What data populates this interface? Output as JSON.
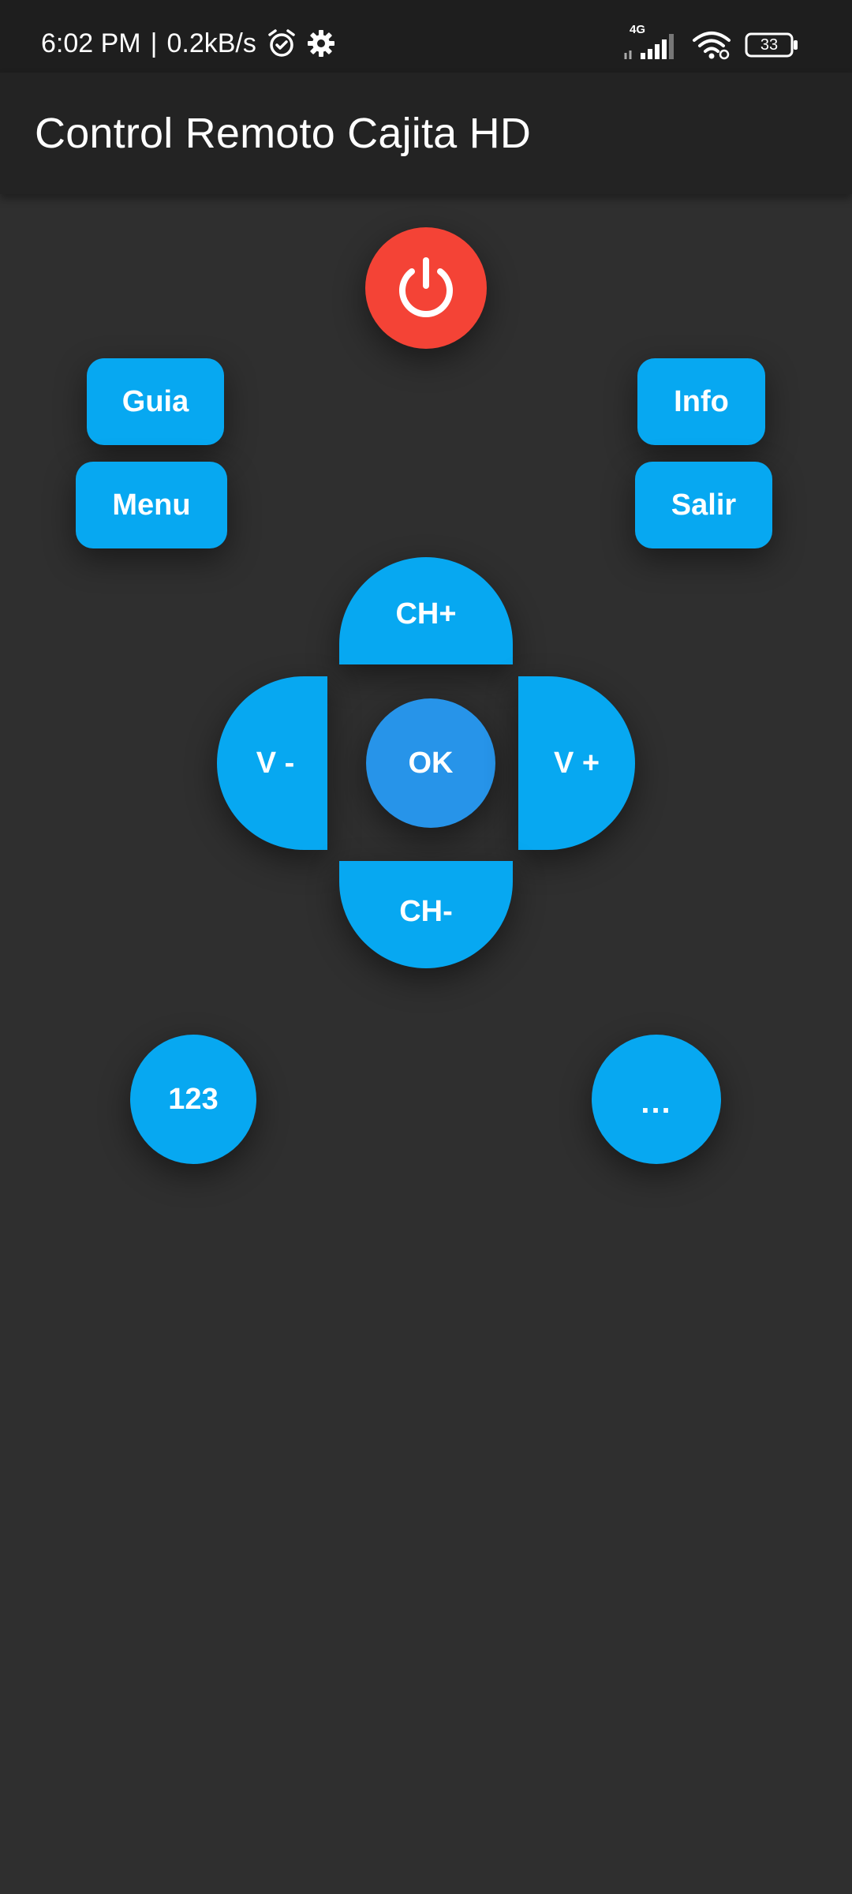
{
  "status_bar": {
    "time": "6:02 PM",
    "separator": "|",
    "speed": "0.2kB/s",
    "network": "4G",
    "battery": "33",
    "icons": [
      "alarm-icon",
      "gear-icon",
      "signal-icon",
      "wifi-icon",
      "battery-icon"
    ]
  },
  "app_bar": {
    "title": "Control Remoto Cajita HD"
  },
  "remote": {
    "power_icon": "power-icon",
    "guia": "Guia",
    "info": "Info",
    "menu": "Menu",
    "salir": "Salir",
    "ch_up": "CH+",
    "ch_down": "CH-",
    "vol_down": "V -",
    "vol_up": "V +",
    "ok": "OK",
    "numbers": "123",
    "more": "..."
  },
  "colors": {
    "background": "#2f2f2f",
    "app_bar": "#232323",
    "status_bar": "#1e1e1e",
    "button": "#07a8f1",
    "ok_button": "#2794e9",
    "power_button": "#f44336"
  }
}
